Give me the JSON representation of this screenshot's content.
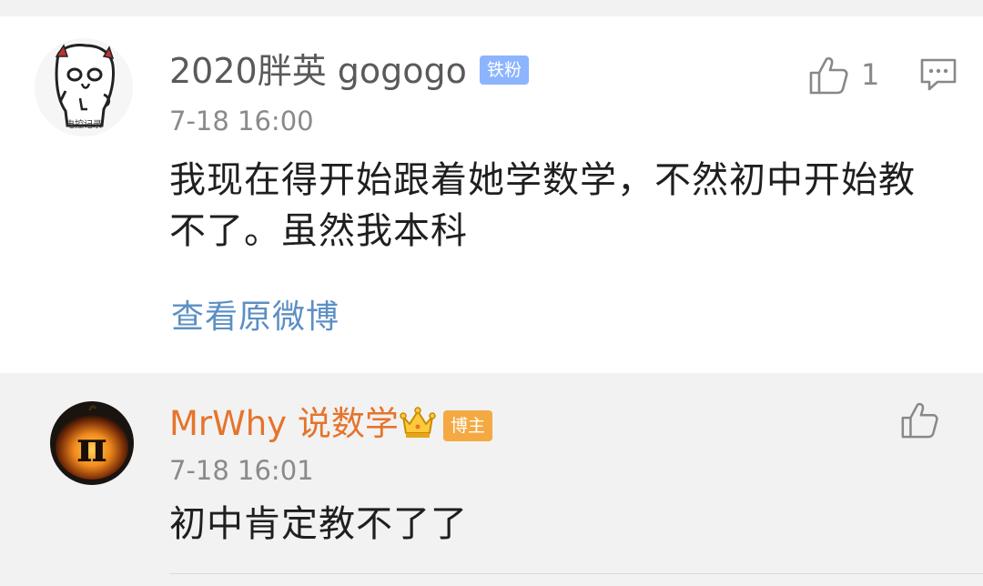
{
  "comment": {
    "username": "2020胖英 gogogo",
    "badge": "铁粉",
    "time": "7-18 16:00",
    "content": "我现在得开始跟着她学数学，不然初中开始教不了。虽然我本科",
    "like_count": "1",
    "view_original": "查看原微博",
    "avatar_caption": "电控记录"
  },
  "reply": {
    "username": "MrWhy 说数学",
    "badge": "博主",
    "time": "7-18 16:01",
    "content": "初中肯定教不了了",
    "avatar_symbol": "π"
  },
  "colors": {
    "link": "#5c8fc4",
    "owner_name": "#e5742c",
    "fan_badge": "#8cb4ff",
    "owner_badge": "#f5a942"
  }
}
